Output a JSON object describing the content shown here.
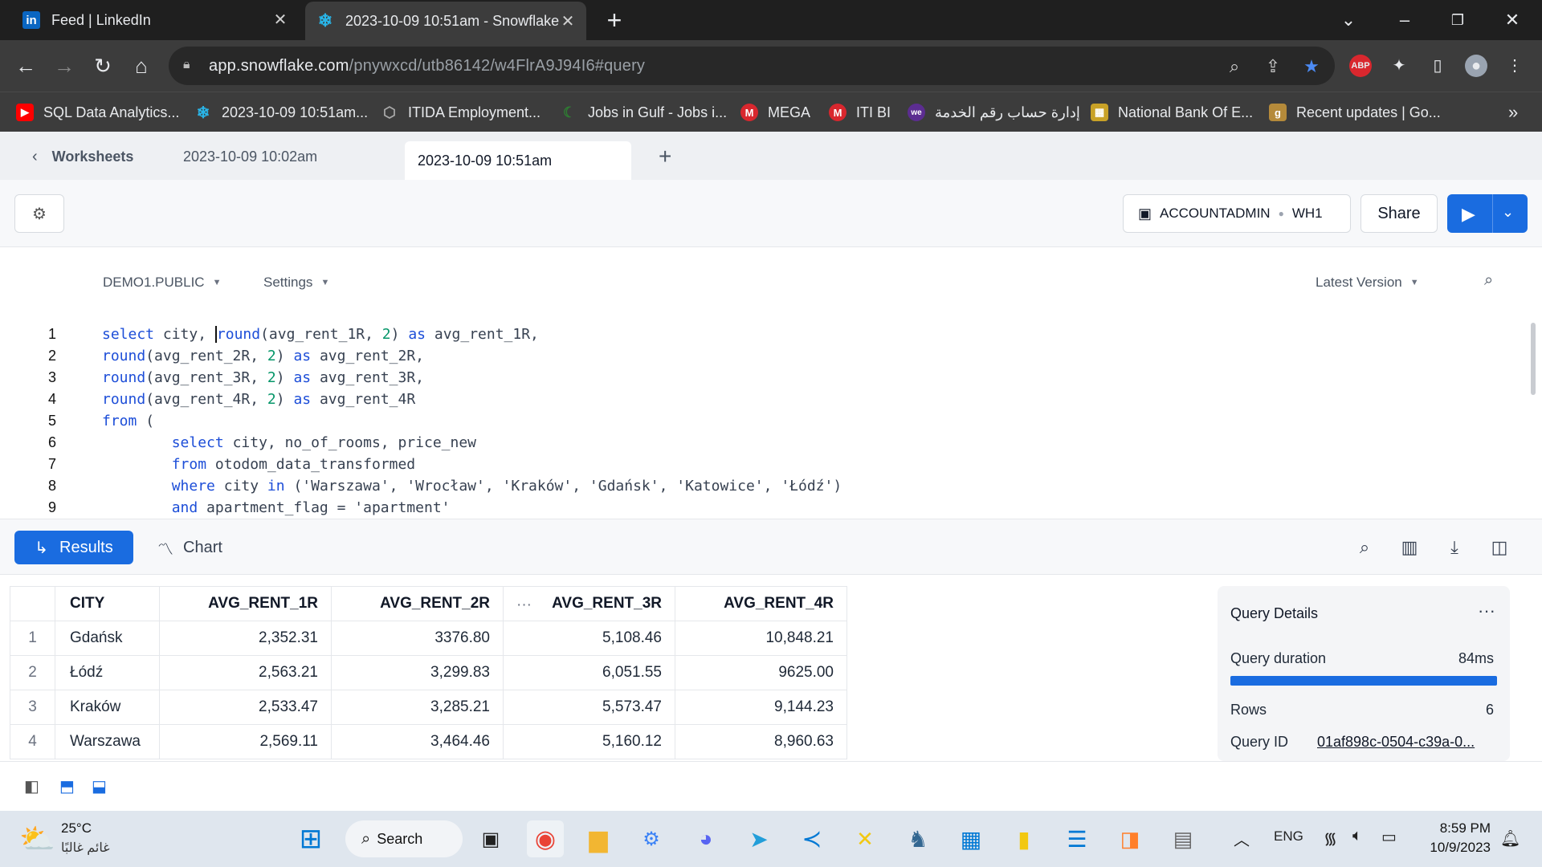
{
  "browser": {
    "tabs": [
      {
        "title": "Feed | LinkedIn",
        "icon": "linkedin-icon"
      },
      {
        "title": "2023-10-09 10:51am - Snowflake",
        "icon": "snowflake-icon"
      }
    ],
    "url_host": "app.snowflake.com",
    "url_path": "/pnywxcd/utb86142/w4FlrA9J94I6#query",
    "bookmarks": [
      {
        "label": "SQL Data Analytics...",
        "icon": "youtube-icon",
        "color": "#ff0000"
      },
      {
        "label": "2023-10-09 10:51am...",
        "icon": "snowflake-icon",
        "color": "#29b5e8"
      },
      {
        "label": "ITIDA Employment...",
        "icon": "itida-icon",
        "color": "#888888"
      },
      {
        "label": "Jobs in Gulf - Jobs i...",
        "icon": "gulf-icon",
        "color": "#2e7d32"
      },
      {
        "label": "MEGA",
        "icon": "mega-icon",
        "color": "#d9272e"
      },
      {
        "label": "ITI BI",
        "icon": "mega-icon",
        "color": "#d9272e"
      },
      {
        "label": "إدارة حساب رقم الخدمة",
        "icon": "we-icon",
        "color": "#5c2d91"
      },
      {
        "label": "National Bank Of E...",
        "icon": "bank-icon",
        "color": "#c9a227"
      },
      {
        "label": "Recent updates | Go...",
        "icon": "g-icon",
        "color": "#b58a3a"
      }
    ]
  },
  "worksheets": {
    "back_label": "Worksheets",
    "tabs": [
      "2023-10-09 10:02am",
      "2023-10-09 10:51am"
    ],
    "active_tab": "2023-10-09 10:51am"
  },
  "toolbar": {
    "role": "ACCOUNTADMIN",
    "warehouse": "WH1",
    "share_label": "Share"
  },
  "editor": {
    "database": "DEMO1.PUBLIC",
    "settings_label": "Settings",
    "version_label": "Latest Version",
    "line_numbers": [
      "1",
      "2",
      "3",
      "4",
      "5",
      "6",
      "7",
      "8",
      "9"
    ]
  },
  "results": {
    "results_label": "Results",
    "chart_label": "Chart",
    "columns": [
      "CITY",
      "AVG_RENT_1R",
      "AVG_RENT_2R",
      "AVG_RENT_3R",
      "AVG_RENT_4R"
    ],
    "ellipsis": "···",
    "rows": [
      {
        "n": "1",
        "city": "Gdańsk",
        "r1": "2,352.31",
        "r2": "3376.80",
        "r3": "5,108.46",
        "r4": "10,848.21"
      },
      {
        "n": "2",
        "city": "Łódź",
        "r1": "2,563.21",
        "r2": "3,299.83",
        "r3": "6,051.55",
        "r4": "9625.00"
      },
      {
        "n": "3",
        "city": "Kraków",
        "r1": "2,533.47",
        "r2": "3,285.21",
        "r3": "5,573.47",
        "r4": "9,144.23"
      },
      {
        "n": "4",
        "city": "Warszawa",
        "r1": "2,569.11",
        "r2": "3,464.46",
        "r3": "5,160.12",
        "r4": "8,960.63"
      }
    ]
  },
  "query_details": {
    "title": "Query Details",
    "duration_label": "Query duration",
    "duration_value": "84ms",
    "rows_label": "Rows",
    "rows_value": "6",
    "id_label": "Query ID",
    "id_value": "01af898c-0504-c39a-0..."
  },
  "taskbar": {
    "weather_temp": "25°C",
    "weather_desc": "غائم غالبًا",
    "search_label": "Search",
    "lang": "ENG",
    "time": "8:59 PM",
    "date": "10/9/2023"
  },
  "colors": {
    "accent": "#1a6ce0",
    "keyword": "#1d4ed8",
    "number": "#059669"
  }
}
